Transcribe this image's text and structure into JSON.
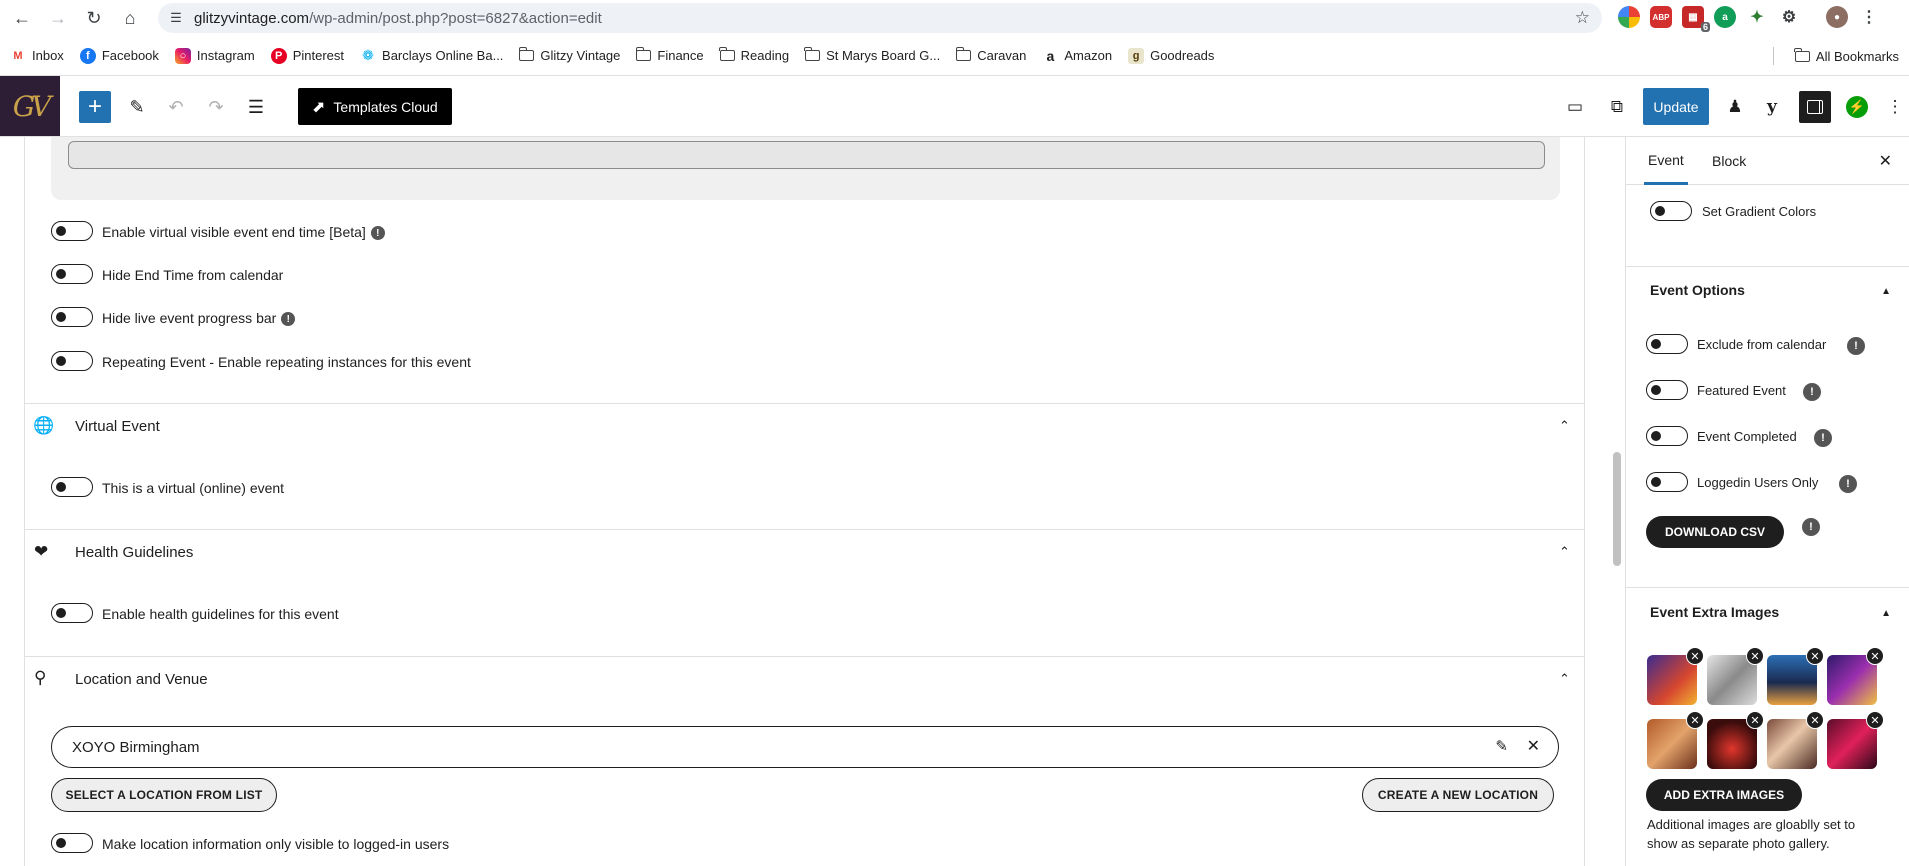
{
  "browser": {
    "url_host": "glitzyvintage.com",
    "url_path": "/wp-admin/post.php?post=6827&action=edit",
    "extension_badge": "6"
  },
  "bookmarks": {
    "items": [
      {
        "label": "Inbox",
        "icon": "gmail-icon"
      },
      {
        "label": "Facebook",
        "icon": "facebook-icon"
      },
      {
        "label": "Instagram",
        "icon": "instagram-icon"
      },
      {
        "label": "Pinterest",
        "icon": "pinterest-icon"
      },
      {
        "label": "Barclays Online Ba...",
        "icon": "barclays-icon"
      },
      {
        "label": "Glitzy Vintage",
        "icon": "folder-icon"
      },
      {
        "label": "Finance",
        "icon": "folder-icon"
      },
      {
        "label": "Reading",
        "icon": "folder-icon"
      },
      {
        "label": "St Marys Board G...",
        "icon": "folder-icon"
      },
      {
        "label": "Caravan",
        "icon": "folder-icon"
      },
      {
        "label": "Amazon",
        "icon": "amazon-icon"
      },
      {
        "label": "Goodreads",
        "icon": "goodreads-icon"
      }
    ],
    "all_bookmarks": "All Bookmarks"
  },
  "editor_header": {
    "logo_text": "GV",
    "templates_cloud": "Templates Cloud",
    "update": "Update"
  },
  "main": {
    "options": {
      "virtual_end_time": "Enable virtual visible event end time [Beta]",
      "hide_end_time": "Hide End Time from calendar",
      "hide_progress": "Hide live event progress bar",
      "repeating": "Repeating Event - Enable repeating instances for this event"
    },
    "virtual_event": {
      "title": "Virtual Event",
      "toggle_label": "This is a virtual (online) event"
    },
    "health": {
      "title": "Health Guidelines",
      "toggle_label": "Enable health guidelines for this event"
    },
    "location": {
      "title": "Location and Venue",
      "value": "XOYO Birmingham",
      "select_btn": "SELECT A LOCATION FROM LIST",
      "create_btn": "CREATE A NEW LOCATION",
      "logged_in_label": "Make location information only visible to logged-in users"
    }
  },
  "sidebar": {
    "tabs": [
      "Event",
      "Block"
    ],
    "gradient_label": "Set Gradient Colors",
    "event_options": {
      "heading": "Event Options",
      "items": [
        "Exclude from calendar",
        "Featured Event",
        "Event Completed",
        "Loggedin Users Only"
      ],
      "download_csv": "DOWNLOAD CSV"
    },
    "extra_images": {
      "heading": "Event Extra Images",
      "add_btn": "ADD EXTRA IMAGES",
      "note": "Additional images are gloablly set to show as separate photo gallery."
    }
  }
}
